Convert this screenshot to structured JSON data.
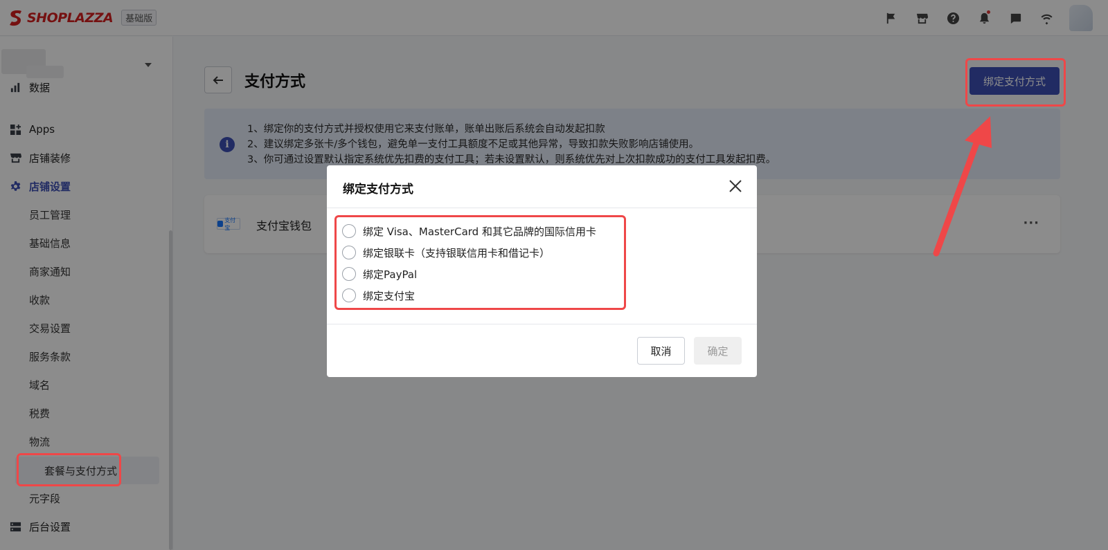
{
  "topbar": {
    "logo_text": "SHOPLAZZA",
    "plan_badge": "基础版",
    "icons": [
      "flag-icon",
      "store-icon",
      "help-icon",
      "bell-icon",
      "message-icon",
      "wifi-icon"
    ]
  },
  "sidebar": {
    "items": [
      {
        "label": "数据",
        "icon": "chart-icon"
      },
      {
        "label": "Apps",
        "icon": "apps-icon"
      },
      {
        "label": "店铺装修",
        "icon": "store-icon"
      },
      {
        "label": "店铺设置",
        "icon": "gear-icon"
      },
      {
        "label": "员工管理"
      },
      {
        "label": "基础信息"
      },
      {
        "label": "商家通知"
      },
      {
        "label": "收款"
      },
      {
        "label": "交易设置"
      },
      {
        "label": "服务条款"
      },
      {
        "label": "域名"
      },
      {
        "label": "税费"
      },
      {
        "label": "物流"
      },
      {
        "label": "套餐与支付方式"
      },
      {
        "label": "元字段"
      },
      {
        "label": "后台设置",
        "icon": "server-icon"
      }
    ]
  },
  "main": {
    "title": "支付方式",
    "primary_button": "绑定支付方式",
    "info_lines": [
      "1、绑定你的支付方式并授权使用它来支付账单，账单出账后系统会自动发起扣款",
      "2、建议绑定多张卡/多个钱包，避免单一支付工具额度不足或其他异常，导致扣款失败影响店铺使用。",
      "3、你可通过设置默认指定系统优先扣费的支付工具；若未设置默认，则系统优先对上次扣款成功的支付工具发起扣费。"
    ],
    "payment_method": {
      "logo_text": "支付宝",
      "name": "支付宝钱包",
      "more": "···"
    }
  },
  "modal": {
    "title": "绑定支付方式",
    "options": [
      "绑定 Visa、MasterCard 和其它品牌的国际信用卡",
      "绑定银联卡（支持银联信用卡和借记卡）",
      "绑定PayPal",
      "绑定支付宝"
    ],
    "cancel": "取消",
    "confirm": "确定"
  },
  "colors": {
    "brand": "#3c4fb4",
    "logo_red": "#d61f1f",
    "annotation_red": "#ef4748",
    "banner_bg": "#e4ebf8"
  }
}
